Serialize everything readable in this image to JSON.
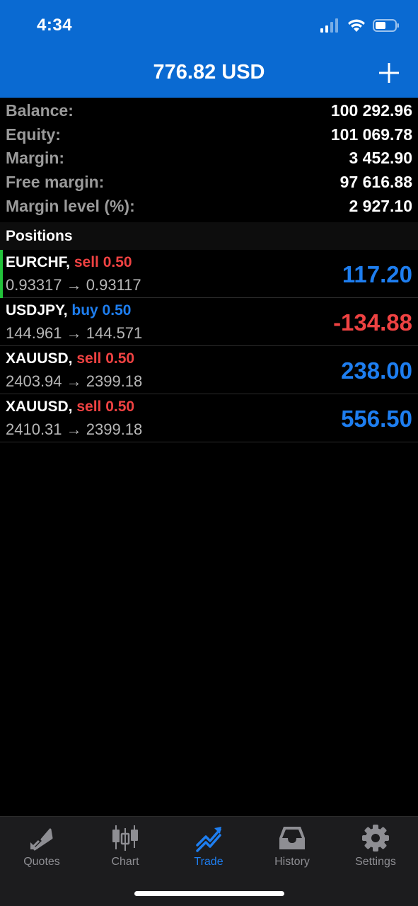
{
  "status_bar": {
    "time": "4:34"
  },
  "header": {
    "title": "776.82 USD"
  },
  "summary": [
    {
      "label": "Balance:",
      "value": "100 292.96"
    },
    {
      "label": "Equity:",
      "value": "101 069.78"
    },
    {
      "label": "Margin:",
      "value": "3 452.90"
    },
    {
      "label": "Free margin:",
      "value": "97 616.88"
    },
    {
      "label": "Margin level (%):",
      "value": "2 927.10"
    }
  ],
  "positions_header": "Positions",
  "positions": [
    {
      "symbol": "EURCHF,",
      "side": "sell 0.50",
      "prices": "0.93317 → 0.93117",
      "profit": "117.20"
    },
    {
      "symbol": "USDJPY,",
      "side": "buy 0.50",
      "prices": "144.961 → 144.571",
      "profit": "-134.88"
    },
    {
      "symbol": "XAUUSD,",
      "side": "sell 0.50",
      "prices": "2403.94 → 2399.18",
      "profit": "238.00"
    },
    {
      "symbol": "XAUUSD,",
      "side": "sell 0.50",
      "prices": "2410.31 → 2399.18",
      "profit": "556.50"
    }
  ],
  "tabs": [
    {
      "label": "Quotes",
      "icon": "quotes-arrows-icon"
    },
    {
      "label": "Chart",
      "icon": "candlestick-icon"
    },
    {
      "label": "Trade",
      "icon": "trade-trend-icon"
    },
    {
      "label": "History",
      "icon": "inbox-tray-icon"
    },
    {
      "label": "Settings",
      "icon": "gear-icon"
    }
  ],
  "colors": {
    "header_bg": "#0a6ad2",
    "sell": "#ef4242",
    "buy": "#1e7ef0",
    "selection": "#22c23a",
    "tab_active": "#1e7ef0"
  }
}
